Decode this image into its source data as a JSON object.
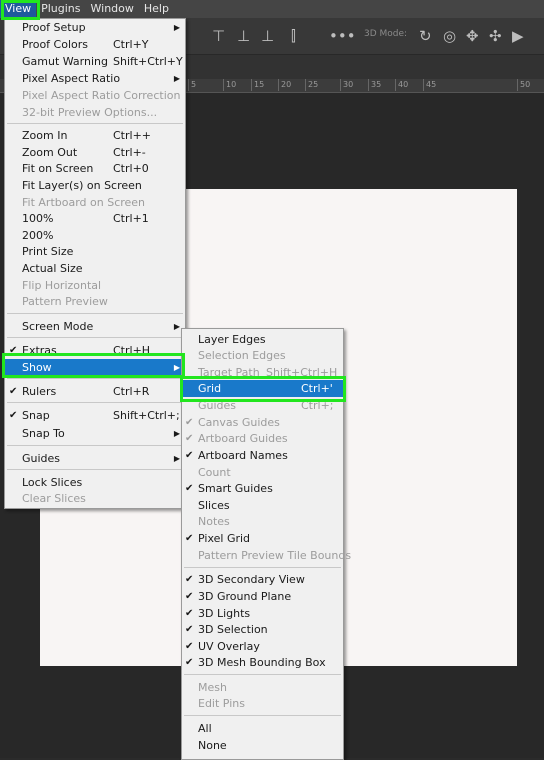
{
  "menubar": {
    "items": [
      "View",
      "Plugins",
      "Window",
      "Help"
    ],
    "active": "View"
  },
  "optionsbar": {
    "mode_label": "3D Mode:"
  },
  "ruler": {
    "ticks": [
      "5",
      "10",
      "15",
      "20",
      "25",
      "30",
      "35",
      "40",
      "45",
      "50"
    ]
  },
  "view_menu": {
    "items": [
      {
        "label": "Proof Setup",
        "shortcut": "",
        "submenu": true,
        "disabled": false,
        "checked": false
      },
      {
        "label": "Proof Colors",
        "shortcut": "Ctrl+Y",
        "submenu": false,
        "disabled": false,
        "checked": false
      },
      {
        "label": "Gamut Warning",
        "shortcut": "Shift+Ctrl+Y",
        "submenu": false,
        "disabled": false,
        "checked": false
      },
      {
        "label": "Pixel Aspect Ratio",
        "shortcut": "",
        "submenu": true,
        "disabled": false,
        "checked": false
      },
      {
        "label": "Pixel Aspect Ratio Correction",
        "shortcut": "",
        "submenu": false,
        "disabled": true,
        "checked": false
      },
      {
        "label": "32-bit Preview Options...",
        "shortcut": "",
        "submenu": false,
        "disabled": true,
        "checked": false
      },
      {
        "label": "Zoom In",
        "shortcut": "Ctrl++",
        "submenu": false,
        "disabled": false,
        "checked": false
      },
      {
        "label": "Zoom Out",
        "shortcut": "Ctrl+-",
        "submenu": false,
        "disabled": false,
        "checked": false
      },
      {
        "label": "Fit on Screen",
        "shortcut": "Ctrl+0",
        "submenu": false,
        "disabled": false,
        "checked": false
      },
      {
        "label": "Fit Layer(s) on Screen",
        "shortcut": "",
        "submenu": false,
        "disabled": false,
        "checked": false
      },
      {
        "label": "Fit Artboard on Screen",
        "shortcut": "",
        "submenu": false,
        "disabled": true,
        "checked": false
      },
      {
        "label": "100%",
        "shortcut": "Ctrl+1",
        "submenu": false,
        "disabled": false,
        "checked": false
      },
      {
        "label": "200%",
        "shortcut": "",
        "submenu": false,
        "disabled": false,
        "checked": false
      },
      {
        "label": "Print Size",
        "shortcut": "",
        "submenu": false,
        "disabled": false,
        "checked": false
      },
      {
        "label": "Actual Size",
        "shortcut": "",
        "submenu": false,
        "disabled": false,
        "checked": false
      },
      {
        "label": "Flip Horizontal",
        "shortcut": "",
        "submenu": false,
        "disabled": true,
        "checked": false
      },
      {
        "label": "Pattern Preview",
        "shortcut": "",
        "submenu": false,
        "disabled": true,
        "checked": false
      },
      {
        "label": "Screen Mode",
        "shortcut": "",
        "submenu": true,
        "disabled": false,
        "checked": false
      },
      {
        "label": "Extras",
        "shortcut": "Ctrl+H",
        "submenu": false,
        "disabled": false,
        "checked": true
      },
      {
        "label": "Show",
        "shortcut": "",
        "submenu": true,
        "disabled": false,
        "checked": false,
        "highlighted": true
      },
      {
        "label": "Rulers",
        "shortcut": "Ctrl+R",
        "submenu": false,
        "disabled": false,
        "checked": true
      },
      {
        "label": "Snap",
        "shortcut": "Shift+Ctrl+;",
        "submenu": false,
        "disabled": false,
        "checked": true
      },
      {
        "label": "Snap To",
        "shortcut": "",
        "submenu": true,
        "disabled": false,
        "checked": false
      },
      {
        "label": "Guides",
        "shortcut": "",
        "submenu": true,
        "disabled": false,
        "checked": false
      },
      {
        "label": "Lock Slices",
        "shortcut": "",
        "submenu": false,
        "disabled": false,
        "checked": false
      },
      {
        "label": "Clear Slices",
        "shortcut": "",
        "submenu": false,
        "disabled": true,
        "checked": false
      }
    ]
  },
  "show_menu": {
    "items": [
      {
        "label": "Layer Edges",
        "shortcut": "",
        "disabled": false,
        "checked": false
      },
      {
        "label": "Selection Edges",
        "shortcut": "",
        "disabled": true,
        "checked": false
      },
      {
        "label": "Target Path",
        "shortcut": "Shift+Ctrl+H",
        "disabled": true,
        "checked": false
      },
      {
        "label": "Grid",
        "shortcut": "Ctrl+'",
        "disabled": false,
        "checked": false,
        "highlighted": true
      },
      {
        "label": "Guides",
        "shortcut": "Ctrl+;",
        "disabled": true,
        "checked": false
      },
      {
        "label": "Canvas Guides",
        "shortcut": "",
        "disabled": true,
        "checked": true
      },
      {
        "label": "Artboard Guides",
        "shortcut": "",
        "disabled": true,
        "checked": true
      },
      {
        "label": "Artboard Names",
        "shortcut": "",
        "disabled": false,
        "checked": true
      },
      {
        "label": "Count",
        "shortcut": "",
        "disabled": true,
        "checked": false
      },
      {
        "label": "Smart Guides",
        "shortcut": "",
        "disabled": false,
        "checked": true
      },
      {
        "label": "Slices",
        "shortcut": "",
        "disabled": false,
        "checked": false
      },
      {
        "label": "Notes",
        "shortcut": "",
        "disabled": true,
        "checked": false
      },
      {
        "label": "Pixel Grid",
        "shortcut": "",
        "disabled": false,
        "checked": true
      },
      {
        "label": "Pattern Preview Tile Bounds",
        "shortcut": "",
        "disabled": true,
        "checked": false
      },
      {
        "label": "3D Secondary View",
        "shortcut": "",
        "disabled": false,
        "checked": true
      },
      {
        "label": "3D Ground Plane",
        "shortcut": "",
        "disabled": false,
        "checked": true
      },
      {
        "label": "3D Lights",
        "shortcut": "",
        "disabled": false,
        "checked": true
      },
      {
        "label": "3D Selection",
        "shortcut": "",
        "disabled": false,
        "checked": true
      },
      {
        "label": "UV Overlay",
        "shortcut": "",
        "disabled": false,
        "checked": true
      },
      {
        "label": "3D Mesh Bounding Box",
        "shortcut": "",
        "disabled": false,
        "checked": true
      },
      {
        "label": "Mesh",
        "shortcut": "",
        "disabled": true,
        "checked": false
      },
      {
        "label": "Edit Pins",
        "shortcut": "",
        "disabled": true,
        "checked": false
      },
      {
        "label": "All",
        "shortcut": "",
        "disabled": false,
        "checked": false
      },
      {
        "label": "None",
        "shortcut": "",
        "disabled": false,
        "checked": false
      }
    ]
  },
  "colors": {
    "highlight": "#1979ca",
    "annotation_box": "#22e61e",
    "menu_bg": "#f0f0f0",
    "workspace_bg": "#282828",
    "document_bg": "#f8f5f4"
  }
}
